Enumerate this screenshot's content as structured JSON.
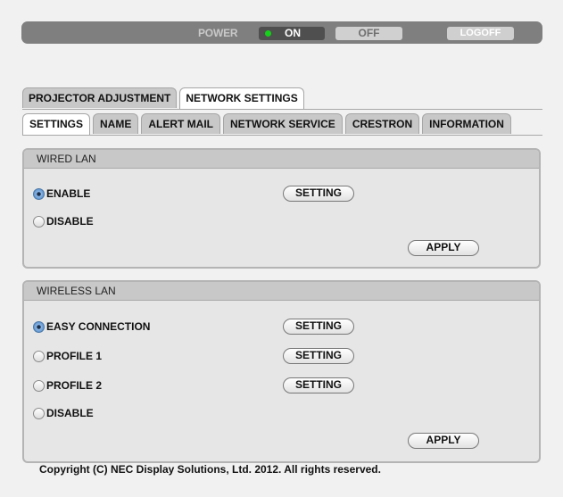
{
  "powerbar": {
    "power_label": "POWER",
    "on_label": "ON",
    "off_label": "OFF",
    "logoff_label": "LOGOFF",
    "power_state": "on",
    "led_color": "#15d11a"
  },
  "main_tabs": [
    {
      "label": "PROJECTOR ADJUSTMENT",
      "active": false
    },
    {
      "label": "NETWORK SETTINGS",
      "active": true
    }
  ],
  "sub_tabs": [
    {
      "label": "SETTINGS",
      "active": true
    },
    {
      "label": "NAME",
      "active": false
    },
    {
      "label": "ALERT MAIL",
      "active": false
    },
    {
      "label": "NETWORK SERVICE",
      "active": false
    },
    {
      "label": "CRESTRON",
      "active": false
    },
    {
      "label": "INFORMATION",
      "active": false
    }
  ],
  "wired_lan": {
    "title": "WIRED LAN",
    "options": [
      {
        "label": "ENABLE",
        "checked": true,
        "setting_label": "SETTING"
      },
      {
        "label": "DISABLE",
        "checked": false
      }
    ],
    "apply_label": "APPLY"
  },
  "wireless_lan": {
    "title": "WIRELESS LAN",
    "options": [
      {
        "label": "EASY CONNECTION",
        "checked": true,
        "setting_label": "SETTING"
      },
      {
        "label": "PROFILE 1",
        "checked": false,
        "setting_label": "SETTING"
      },
      {
        "label": "PROFILE 2",
        "checked": false,
        "setting_label": "SETTING"
      },
      {
        "label": "DISABLE",
        "checked": false
      }
    ],
    "apply_label": "APPLY"
  },
  "footer": {
    "copyright": "Copyright (C) NEC Display Solutions, Ltd. 2012. All rights reserved."
  }
}
